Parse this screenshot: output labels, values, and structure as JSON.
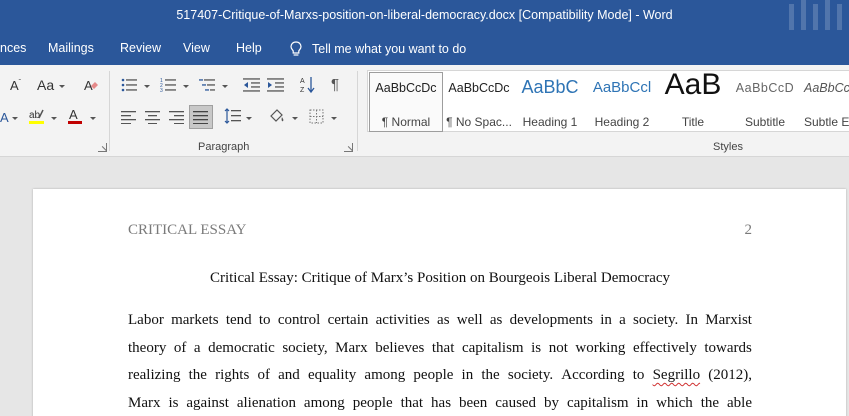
{
  "window": {
    "title": "517407-Critique-of-Marxs-position-on-liberal-democracy.docx [Compatibility Mode]  -  Word"
  },
  "menu": {
    "tabs": [
      "nces",
      "Mailings",
      "Review",
      "View",
      "Help"
    ],
    "tell_me": "Tell me what you want to do"
  },
  "ribbon": {
    "paragraph_label": "Paragraph",
    "styles_label": "Styles",
    "styles": [
      {
        "preview": "AaBbCcDc",
        "name": "¶ Normal"
      },
      {
        "preview": "AaBbCcDc",
        "name": "¶ No Spac..."
      },
      {
        "preview": "AaBbC",
        "name": "Heading 1"
      },
      {
        "preview": "AaBbCcl",
        "name": "Heading 2"
      },
      {
        "preview": "AaB",
        "name": "Title"
      },
      {
        "preview": "AaBbCcD",
        "name": "Subtitle"
      },
      {
        "preview": "AaBbCcL",
        "name": "Subtle Em"
      }
    ],
    "font_color": "#c00000",
    "highlight_color": "#ffff00",
    "accent": "#2b579a"
  },
  "document": {
    "header": "CRITICAL ESSAY",
    "page_number": "2",
    "title": "Critical Essay: Critique of Marx’s Position on Bourgeois Liberal Democracy",
    "lines": [
      "Labor markets tend to control certain activities as well as developments in a society. In Marxist",
      "theory of a democratic society, Marx believes that capitalism is not working effectively towards",
      "realizing the rights of and equality among people in the society. According to Segrillo (2012),",
      "Marx is against alienation among people that has been caused by capitalism in which the able"
    ],
    "flagged_word": "Segrillo"
  }
}
